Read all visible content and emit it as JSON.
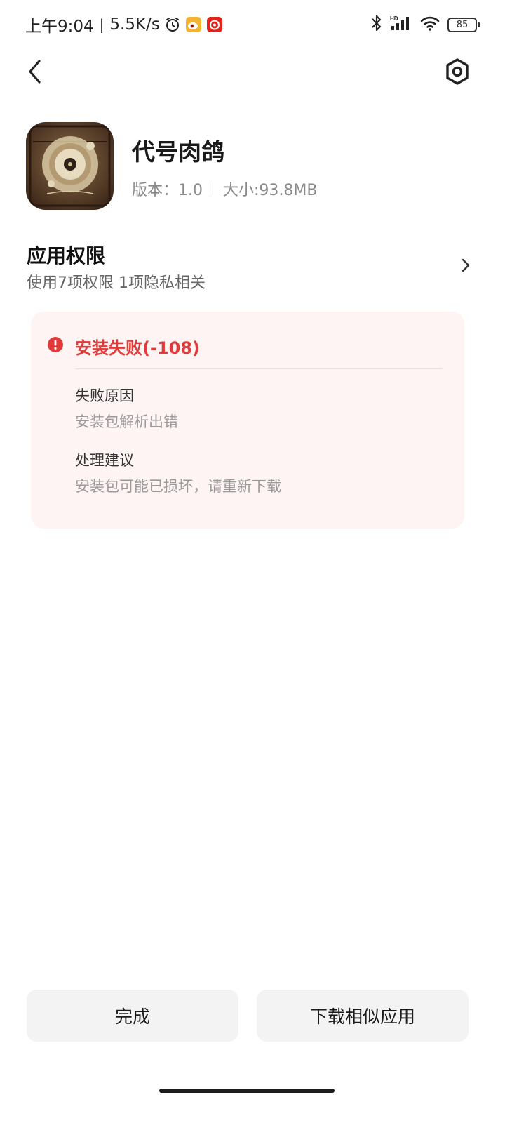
{
  "status_bar": {
    "time": "上午9:04",
    "separator": "|",
    "net_speed": "5.5K/s",
    "battery": "85",
    "icons": [
      "alarm-icon",
      "weibo-icon",
      "netease-music-icon",
      "bluetooth-icon",
      "hd-signal-icon",
      "wifi-icon",
      "battery-icon"
    ]
  },
  "nav": {
    "back_icon": "chevron-left-icon",
    "settings_icon": "hex-settings-icon"
  },
  "app": {
    "name": "代号肉鸽",
    "version_label": "版本：1.0",
    "size_label": "大小:93.8MB"
  },
  "permissions": {
    "title": "应用权限",
    "subtitle": "使用7项权限 1项隐私相关"
  },
  "error": {
    "title": "安装失败(-108)",
    "reason_label": "失败原因",
    "reason_value": "安装包解析出错",
    "advice_label": "处理建议",
    "advice_value": "安装包可能已损坏，请重新下载",
    "accent_color": "#e13a3a"
  },
  "buttons": {
    "done": "完成",
    "download_similar": "下载相似应用"
  }
}
